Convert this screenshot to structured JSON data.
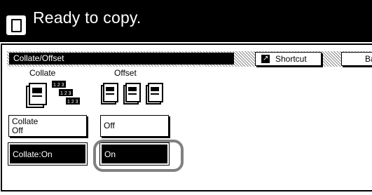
{
  "status": {
    "message": "Ready to copy."
  },
  "header": {
    "title": "Collate/Offset"
  },
  "toolbar": {
    "shortcut_label": "Shortcut",
    "back_label": "Ba"
  },
  "collate": {
    "label": "Collate",
    "stack_labels": [
      "1 2 3",
      "1 2 3",
      "1 2 3"
    ],
    "off_label_line1": "Collate",
    "off_label_line2": "Off",
    "on_label": "Collate:On"
  },
  "offset": {
    "label": "Offset",
    "off_label": "Off",
    "on_label": "On"
  }
}
